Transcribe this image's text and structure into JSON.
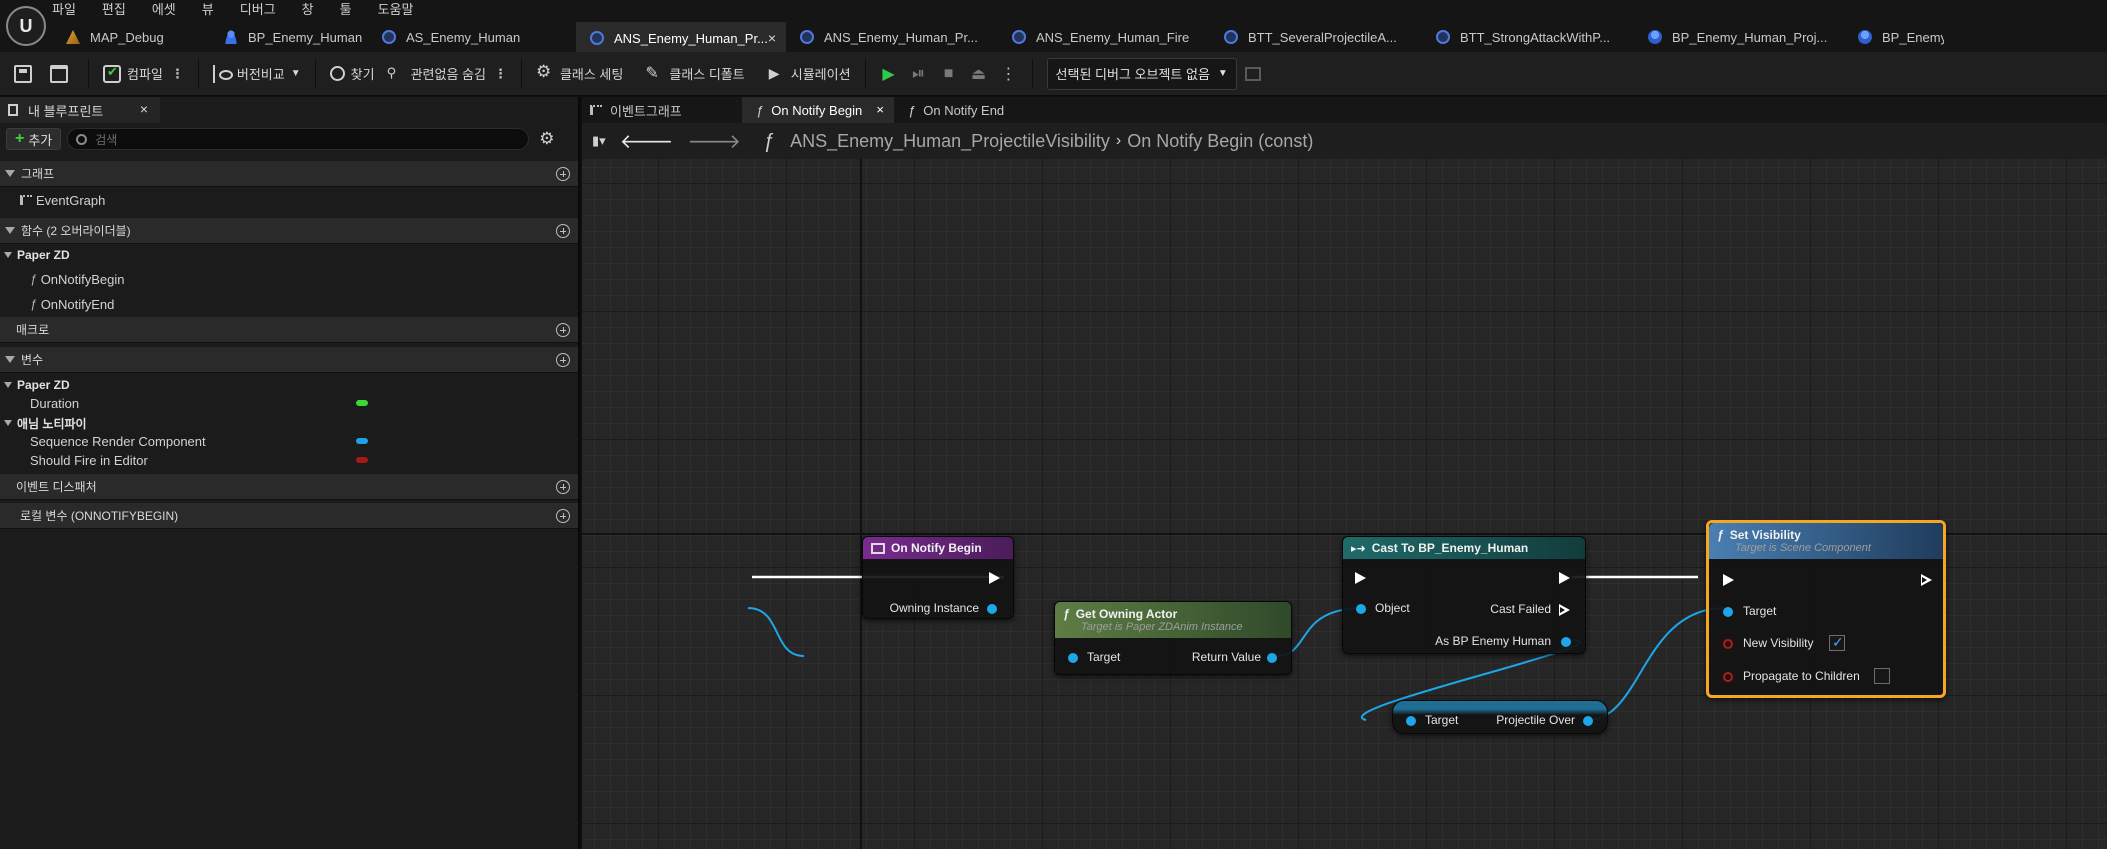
{
  "app": {
    "logo_text": "U",
    "menu": [
      "파일",
      "편집",
      "에셋",
      "뷰",
      "디버그",
      "창",
      "툴",
      "도움말"
    ],
    "doc_tabs": [
      {
        "label": "MAP_Debug",
        "icon": "level-icon",
        "active": false
      },
      {
        "label": "BP_Enemy_Human",
        "icon": "character-icon",
        "active": false
      },
      {
        "label": "AS_Enemy_Human",
        "icon": "blueprint-icon",
        "active": false
      },
      {
        "label": "ANS_Enemy_Human_Pr...",
        "icon": "blueprint-icon",
        "active": true
      },
      {
        "label": "ANS_Enemy_Human_Pr...",
        "icon": "blueprint-icon",
        "active": false
      },
      {
        "label": "ANS_Enemy_Human_Fire",
        "icon": "blueprint-icon",
        "active": false
      },
      {
        "label": "BTT_SeveralProjectileA...",
        "icon": "blueprint-icon",
        "active": false
      },
      {
        "label": "BTT_StrongAttackWithP...",
        "icon": "blueprint-icon",
        "active": false
      },
      {
        "label": "BP_Enemy_Human_Proj...",
        "icon": "blueprint-icon",
        "active": false
      },
      {
        "label": "BP_Enemy_Hu",
        "icon": "blueprint-icon",
        "active": false
      }
    ]
  },
  "toolbar": {
    "compile": "컴파일",
    "diff": "버전비교",
    "find": "찾기",
    "hide_unrelated": "관련없음 숨김",
    "class_settings": "클래스 세팅",
    "class_defaults": "클래스 디폴트",
    "simulation": "시뮬레이션",
    "debug_object": "선택된 디버그 오브젝트 없음"
  },
  "left_panel": {
    "tab_title": "내 블루프린트",
    "add_label": "추가",
    "search_placeholder": "검색",
    "sections": {
      "graphs": "그래프",
      "functions": "함수 (2 오버라이더블)",
      "macros": "매크로",
      "variables": "변수",
      "dispatchers": "이벤트 디스패처",
      "locals": "로컬 변수 (ONNOTIFYBEGIN)"
    },
    "graph_items": [
      "EventGraph"
    ],
    "function_category": "Paper ZD",
    "function_items": [
      "OnNotifyBegin",
      "OnNotifyEnd"
    ],
    "var_category_1": "Paper ZD",
    "var_category_2": "애님 노티파이",
    "variables": [
      {
        "name": "Duration",
        "color": "#3cd53a"
      },
      {
        "name": "Sequence Render Component",
        "color": "#1f9fe6"
      },
      {
        "name": "Should Fire in Editor",
        "color": "#a51b14"
      }
    ]
  },
  "graph": {
    "tabs": [
      "이벤트그래프",
      "On Notify Begin",
      "On Notify End"
    ],
    "active_tab": "On Notify Begin",
    "breadcrumb": [
      "ANS_Enemy_Human_ProjectileVisibility",
      "On Notify Begin (const)"
    ],
    "nodes": {
      "on_notify_begin": {
        "title": "On Notify Begin",
        "pin_owning": "Owning Instance",
        "color": "#6b2680"
      },
      "get_owning_actor": {
        "title": "Get Owning Actor",
        "subtitle": "Target is Paper ZDAnim Instance",
        "pin_target": "Target",
        "pin_return": "Return Value",
        "color": "#4d6b3a"
      },
      "cast": {
        "title": "Cast To BP_Enemy_Human",
        "pin_object": "Object",
        "pin_cast_failed": "Cast Failed",
        "pin_as": "As BP Enemy Human",
        "color": "#1d5a5a"
      },
      "projectile_over": {
        "pin_target": "Target",
        "pin_value": "Projectile Over"
      },
      "set_visibility": {
        "title": "Set Visibility",
        "subtitle": "Target is Scene Component",
        "pin_target": "Target",
        "pin_new_visibility": "New Visibility",
        "pin_propagate": "Propagate to Children",
        "new_visibility_checked": true,
        "propagate_checked": false,
        "color": "#3a6a9a"
      }
    }
  }
}
